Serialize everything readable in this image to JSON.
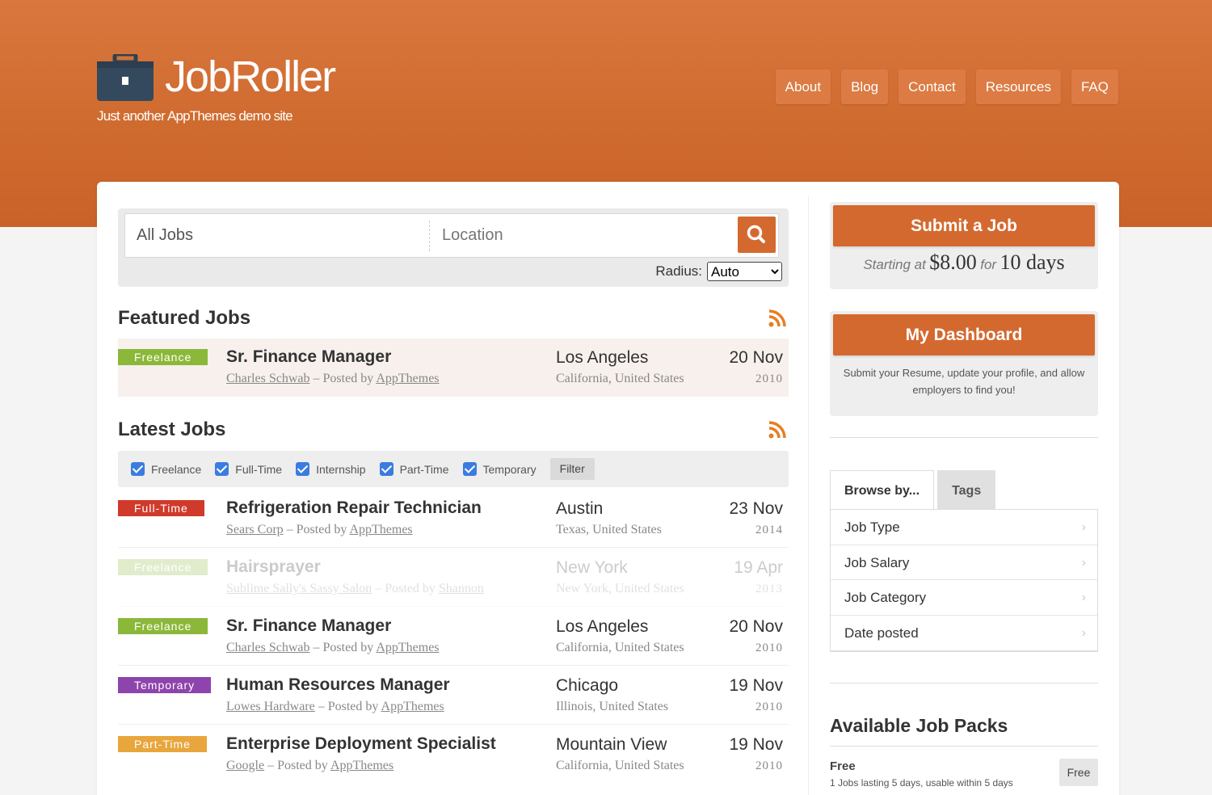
{
  "site": {
    "name": "JobRoller",
    "tagline": "Just another AppThemes demo site"
  },
  "nav": [
    "About",
    "Blog",
    "Contact",
    "Resources",
    "FAQ"
  ],
  "search": {
    "keyword_value": "All Jobs",
    "location_placeholder": "Location",
    "radius_label": "Radius:",
    "radius_value": "Auto"
  },
  "featured": {
    "title": "Featured Jobs",
    "jobs": [
      {
        "type": "Freelance",
        "title": "Sr. Finance Manager",
        "company": "Charles Schwab",
        "posted_sep": " – Posted by ",
        "poster": "AppThemes",
        "city": "Los Angeles",
        "region": "California, United States",
        "day": "20 Nov",
        "year": "2010"
      }
    ]
  },
  "latest": {
    "title": "Latest Jobs",
    "filters": [
      "Freelance",
      "Full-Time",
      "Internship",
      "Part-Time",
      "Temporary"
    ],
    "filter_button": "Filter",
    "jobs": [
      {
        "type": "Full-Time",
        "title": "Refrigeration Repair Technician",
        "company": "Sears Corp",
        "posted_sep": " – Posted by ",
        "poster": "AppThemes",
        "city": "Austin",
        "region": "Texas, United States",
        "day": "23 Nov",
        "year": "2014"
      },
      {
        "type": "Freelance",
        "title": "Hairsprayer",
        "company": "Sublime Sally's Sassy Salon",
        "posted_sep": " – Posted by ",
        "poster": "Shannon",
        "city": "New York",
        "region": "New York, United States",
        "day": "19 Apr",
        "year": "2013"
      },
      {
        "type": "Freelance",
        "title": "Sr. Finance Manager",
        "company": "Charles Schwab",
        "posted_sep": " – Posted by ",
        "poster": "AppThemes",
        "city": "Los Angeles",
        "region": "California, United States",
        "day": "20 Nov",
        "year": "2010"
      },
      {
        "type": "Temporary",
        "title": "Human Resources Manager",
        "company": "Lowes Hardware",
        "posted_sep": " – Posted by ",
        "poster": "AppThemes",
        "city": "Chicago",
        "region": "Illinois, United States",
        "day": "19 Nov",
        "year": "2010"
      },
      {
        "type": "Part-Time",
        "title": "Enterprise Deployment Specialist",
        "company": "Google",
        "posted_sep": " – Posted by ",
        "poster": "AppThemes",
        "city": "Mountain View",
        "region": "California, United States",
        "day": "19 Nov",
        "year": "2010"
      }
    ]
  },
  "sidebar": {
    "submit": {
      "button": "Submit a Job",
      "starting": "Starting at",
      "price": "$8.00",
      "for": "for",
      "duration": "10 days"
    },
    "dashboard": {
      "button": "My Dashboard",
      "desc": "Submit your Resume, update your profile, and allow employers to find you!"
    },
    "browse": {
      "tabs": [
        "Browse by...",
        "Tags"
      ],
      "items": [
        "Job Type",
        "Job Salary",
        "Job Category",
        "Date posted"
      ]
    },
    "packs": {
      "title": "Available Job Packs",
      "name": "Free",
      "desc": "1 Jobs lasting 5 days, usable within 5 days",
      "button": "Free"
    }
  },
  "colors": {
    "brand": "#d4692f",
    "Freelance": "#8cb83a",
    "Full-Time": "#d03a2b",
    "Temporary": "#8e44ad",
    "Part-Time": "#e8a63d"
  }
}
